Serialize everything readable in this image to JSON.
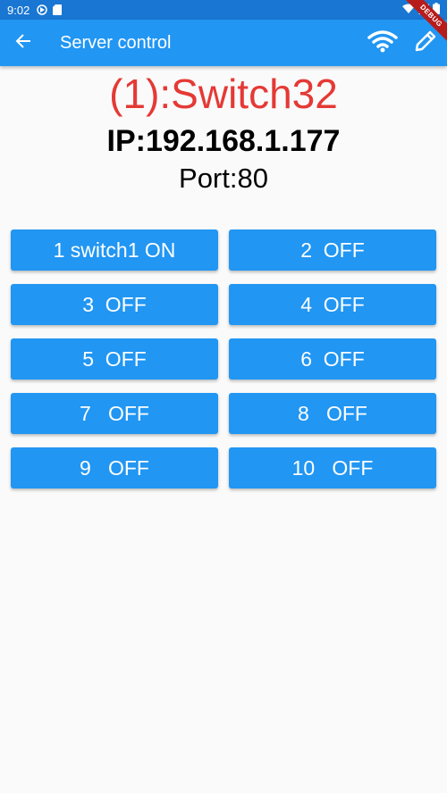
{
  "status_bar": {
    "time": "9:02",
    "icons": [
      "media-icon",
      "sd-card-icon",
      "wifi-icon",
      "signal-icon",
      "battery-icon"
    ],
    "background": "#1976d2"
  },
  "debug_banner": "DEBUG",
  "app_bar": {
    "title": "Server control",
    "background": "#2196f3",
    "leading_icon": "back-arrow-icon",
    "actions": [
      "wifi-icon",
      "edit-pencil-icon"
    ]
  },
  "device": {
    "name": "(1):Switch32",
    "name_color": "#e53935",
    "ip": "IP:192.168.1.177",
    "port": "Port:80"
  },
  "switches": [
    {
      "label": "1 switch1 ON"
    },
    {
      "label": "2  OFF"
    },
    {
      "label": "3  OFF"
    },
    {
      "label": "4  OFF"
    },
    {
      "label": "5  OFF"
    },
    {
      "label": "6  OFF"
    },
    {
      "label": "7   OFF"
    },
    {
      "label": "8   OFF"
    },
    {
      "label": "9   OFF"
    },
    {
      "label": "10   OFF"
    }
  ],
  "button_color": "#2196f3"
}
